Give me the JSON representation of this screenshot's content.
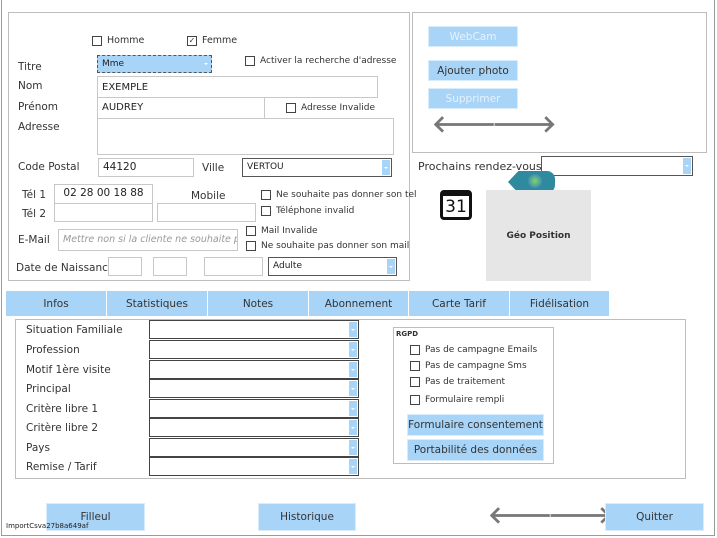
{
  "identity": {
    "homme": "Homme",
    "femme": "Femme",
    "titre_label": "Titre",
    "titre_value": "Mme",
    "activer_recherche": "Activer la recherche d'adresse",
    "nom_label": "Nom",
    "nom_value": "EXEMPLE",
    "prenom_label": "Prénom",
    "prenom_value": "AUDREY",
    "adresse_invalide": "Adresse Invalide",
    "adresse_label": "Adresse",
    "cp_label": "Code Postal",
    "cp_value": "44120",
    "ville_label": "Ville",
    "ville_value": "VERTOU",
    "tel1_label": "Tél 1",
    "tel1_value": "02 28 00 18 88",
    "mobile_label": "Mobile",
    "tel2_label": "Tél 2",
    "no_tel": "Ne souhaite pas donner son tel",
    "tel_invalid": "Téléphone invalid",
    "email_label": "E-Mail",
    "email_placeholder": "Mettre non si la cliente ne souhaite pas",
    "mail_invalide": "Mail Invalide",
    "no_mail": "Ne souhaite pas donner son mail",
    "dob_label": "Date de Naissance",
    "age_value": "Adulte"
  },
  "photo": {
    "webcam": "WebCam",
    "ajouter": "Ajouter photo",
    "supprimer": "Supprimer"
  },
  "rdv": {
    "label": "Prochains rendez-vous",
    "calendar_day": "31",
    "geo": "Géo Position"
  },
  "tabs": [
    "Infos",
    "Statistiques",
    "Notes",
    "Abonnement",
    "Carte Tarif",
    "Fidélisation"
  ],
  "infos": {
    "fields": [
      "Situation Familiale",
      "Profession",
      "Motif 1ère visite",
      "Principal",
      "Critère libre 1",
      "Critère libre 2",
      "Pays",
      "Remise / Tarif"
    ]
  },
  "rgpd": {
    "title": "RGPD",
    "options": [
      "Pas de campagne Emails",
      "Pas de campagne Sms",
      "Pas de traitement",
      "Formulaire rempli"
    ],
    "consent_btn": "Formulaire consentement",
    "portability_btn": "Portabilité des données"
  },
  "footer": {
    "filleul": "Filleul",
    "historique": "Historique",
    "quitter": "Quitter",
    "import_id": "ImportCsva27b8a649af"
  }
}
